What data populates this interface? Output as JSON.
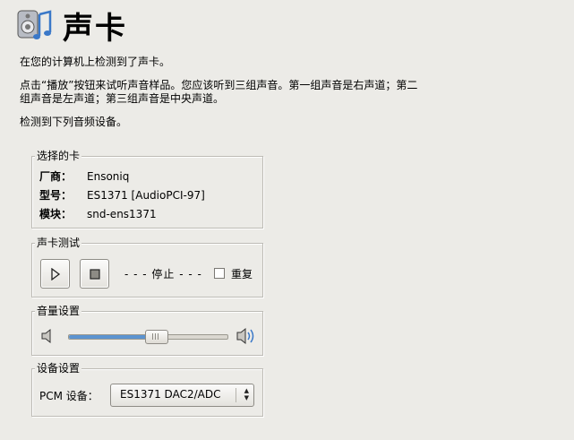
{
  "header": {
    "title": "声卡",
    "icon": "sound-card-icon"
  },
  "intro": {
    "detected": "在您的计算机上检测到了声卡。",
    "instruction_line1": "点击“播放”按钮来试听声音样品。您应该听到三组声音。第一组声音是右声道；第二",
    "instruction_line2": "组声音是左声道；第三组声音是中央声道。",
    "devices_found": "检测到下列音频设备。"
  },
  "card_frame": {
    "legend": "选择的卡",
    "rows": [
      {
        "key": "厂商：",
        "value": "Ensoniq"
      },
      {
        "key": "型号：",
        "value": "ES1371 [AudioPCI-97]"
      },
      {
        "key": "模块：",
        "value": "snd-ens1371"
      }
    ]
  },
  "test_frame": {
    "legend": "声卡测试",
    "play_icon": "play-icon",
    "stop_icon": "stop-icon",
    "status": "- - -  停止 - - -",
    "repeat_label": "重复",
    "repeat_checked": false
  },
  "volume_frame": {
    "legend": "音量设置",
    "level": 0.55,
    "low_icon": "volume-low-icon",
    "high_icon": "volume-high-icon",
    "fill_color": "#5b93d0"
  },
  "device_frame": {
    "legend": "设备设置",
    "pcm_label": "PCM 设备：",
    "pcm_value": "ES1371 DAC2/ADC"
  }
}
